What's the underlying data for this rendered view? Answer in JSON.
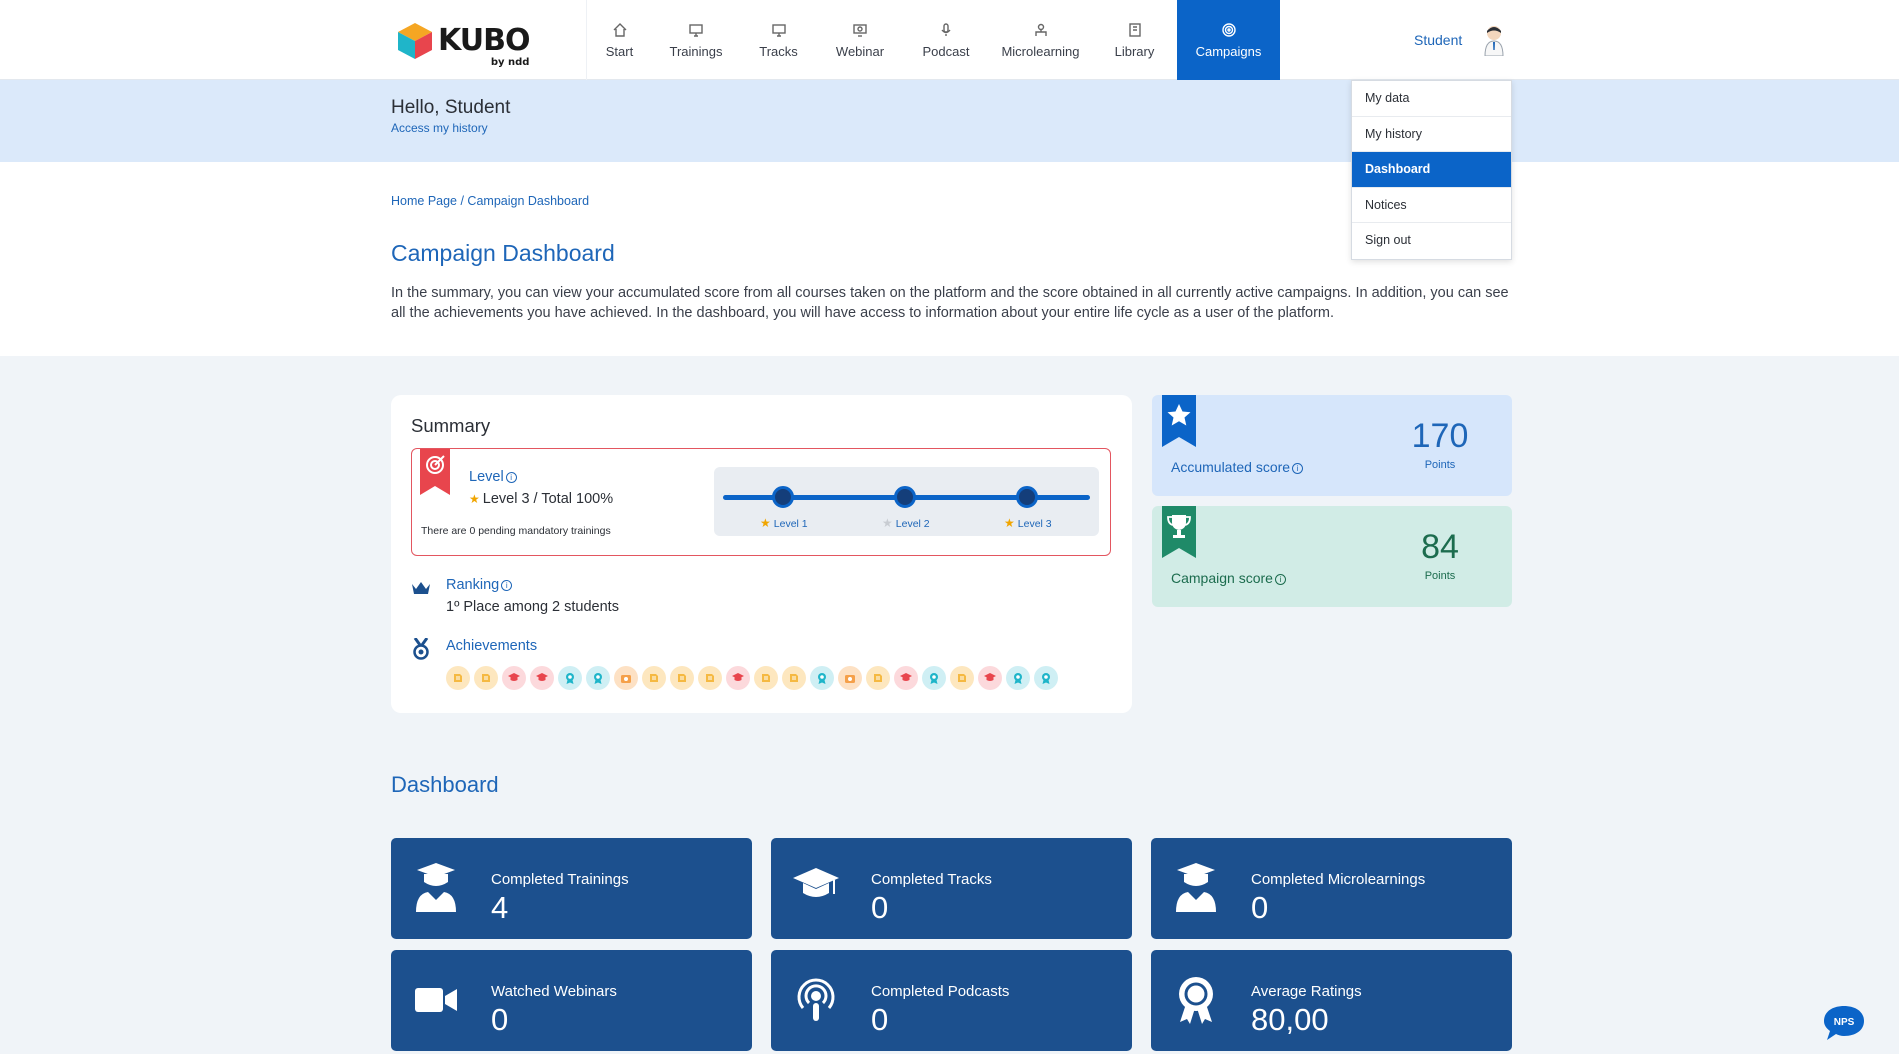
{
  "header": {
    "logo_text": "KUBO",
    "logo_sub": "by ndd",
    "nav": [
      {
        "label": "Start",
        "icon": "home-icon"
      },
      {
        "label": "Trainings",
        "icon": "monitor-icon"
      },
      {
        "label": "Tracks",
        "icon": "monitor-icon"
      },
      {
        "label": "Webinar",
        "icon": "webinar-icon"
      },
      {
        "label": "Podcast",
        "icon": "microphone-icon"
      },
      {
        "label": "Microlearning",
        "icon": "microlearning-icon"
      },
      {
        "label": "Library",
        "icon": "book-icon"
      },
      {
        "label": "Campaigns",
        "icon": "target-icon",
        "active": true
      }
    ],
    "user_name": "Student"
  },
  "user_menu": {
    "items": [
      "My data",
      "My history",
      "Dashboard",
      "Notices",
      "Sign out"
    ],
    "active": "Dashboard"
  },
  "greeting": {
    "title": "Hello, Student",
    "link": "Access my history"
  },
  "breadcrumb": "Home Page / Campaign Dashboard",
  "page_title": "Campaign Dashboard",
  "page_description": "In the summary, you can view your accumulated score from all courses taken on the platform and the score obtained in all currently active campaigns. In addition, you can see all the achievements you have achieved. In the dashboard, you will have access to information about your entire life cycle as a user of the platform.",
  "summary": {
    "title": "Summary",
    "level_label": "Level",
    "level_value": "Level 3 / Total 100%",
    "pending": "There are 0 pending mandatory trainings",
    "progress_levels": [
      "Level 1",
      "Level 2",
      "Level 3"
    ],
    "ranking_label": "Ranking",
    "ranking_value": "1º Place among 2 students",
    "achievements_label": "Achievements",
    "achievements": [
      "yellow",
      "yellow",
      "red",
      "red",
      "teal",
      "teal",
      "orange",
      "yellow",
      "yellow",
      "yellow",
      "red",
      "yellow",
      "yellow",
      "teal",
      "orange",
      "yellow",
      "red",
      "teal",
      "yellow",
      "red",
      "teal",
      "teal"
    ]
  },
  "scores": {
    "accumulated": {
      "label": "Accumulated score",
      "value": "170",
      "unit": "Points"
    },
    "campaign": {
      "label": "Campaign score",
      "value": "84",
      "unit": "Points"
    }
  },
  "dashboard": {
    "title": "Dashboard",
    "tiles": [
      {
        "label": "Completed Trainings",
        "value": "4",
        "icon": "graduate-icon"
      },
      {
        "label": "Completed Tracks",
        "value": "0",
        "icon": "graduation-cap-icon"
      },
      {
        "label": "Completed Microlearnings",
        "value": "0",
        "icon": "graduate-icon"
      },
      {
        "label": "Watched Webinars",
        "value": "0",
        "icon": "video-camera-icon"
      },
      {
        "label": "Completed Podcasts",
        "value": "0",
        "icon": "podcast-icon"
      },
      {
        "label": "Average Ratings",
        "value": "80,00",
        "icon": "award-icon"
      }
    ]
  },
  "nps_label": "NPS",
  "colors": {
    "primary": "#0b64c8",
    "tile": "#1c508e",
    "accent_red": "#e35660",
    "accumulated_bg": "#d6e6fb",
    "campaign_bg": "#d1ece6"
  }
}
